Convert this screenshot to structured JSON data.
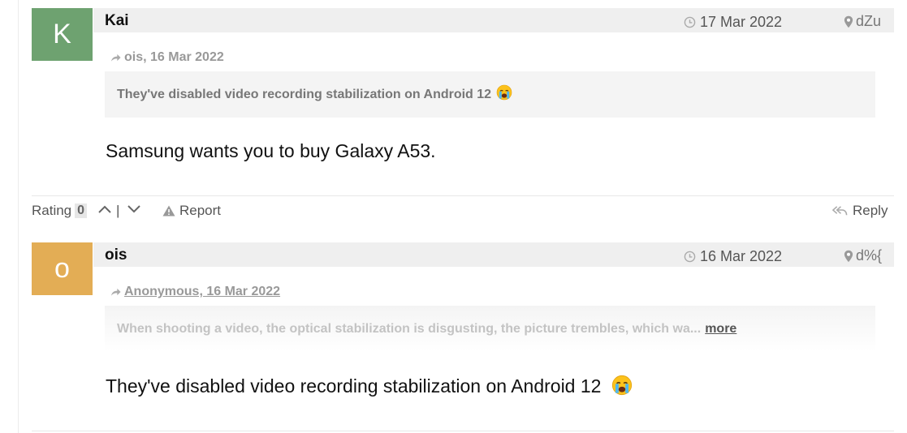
{
  "comments": [
    {
      "avatar_letter": "K",
      "avatar_color": "#6ea270",
      "author": "Kai",
      "date": "17 Mar 2022",
      "location": "dZu",
      "reply_to": "ois, 16 Mar 2022",
      "quote": "They've disabled video recording stabilization on Android 12",
      "text": "Samsung wants you to buy Galaxy A53."
    },
    {
      "avatar_letter": "o",
      "avatar_color": "#e3ad55",
      "author": "ois",
      "date": "16 Mar 2022",
      "location": "d%{",
      "reply_to": "Anonymous, 16 Mar 2022",
      "quote": "When shooting a video, the optical stabilization is disgusting, the picture trembles, which wa...",
      "quote_more": "more",
      "text": "They've disabled video recording stabilization on Android 12"
    }
  ],
  "actions": {
    "rating_label": "Rating",
    "rating_count": "0",
    "vote_separator": "|",
    "report_label": "Report",
    "reply_label": "Reply"
  },
  "icons": {
    "date": "clock-icon",
    "location": "map-pin-icon",
    "reply_to": "forward-arrow-icon",
    "upvote": "chevron-up-icon",
    "downvote": "chevron-down-icon",
    "report": "warning-icon",
    "reply": "reply-all-icon",
    "emoji": "crying-face-icon"
  }
}
